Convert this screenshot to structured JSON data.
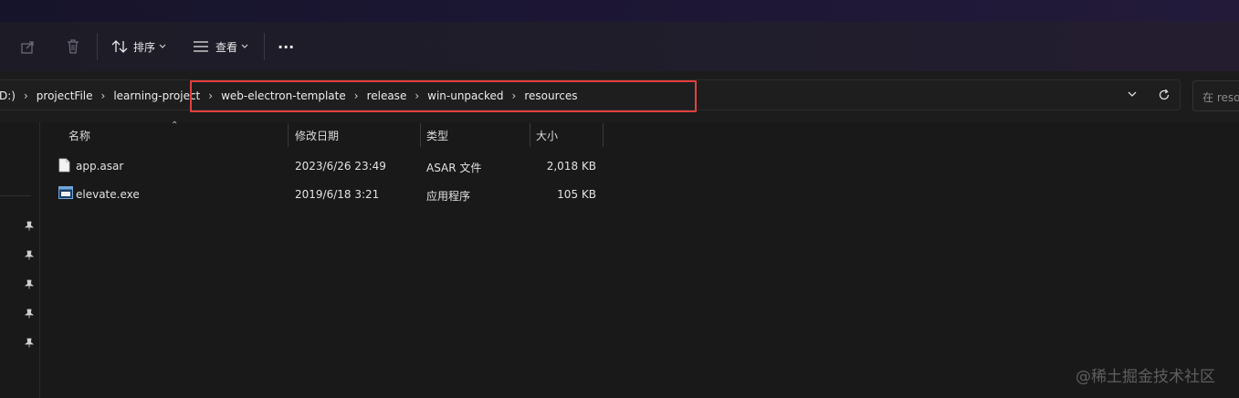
{
  "toolbar": {
    "sort_label": "排序",
    "view_label": "查看",
    "more_label": "···"
  },
  "address": {
    "crumbs": [
      "D:)",
      "projectFile",
      "learning-project",
      "web-electron-template",
      "release",
      "win-unpacked",
      "resources"
    ],
    "search_placeholder": "在 resources"
  },
  "columns": {
    "name": "名称",
    "modified": "修改日期",
    "type": "类型",
    "size": "大小"
  },
  "files": [
    {
      "name": "app.asar",
      "modified": "2023/6/26 23:49",
      "type": "ASAR 文件",
      "size": "2,018 KB",
      "icon": "file-icon"
    },
    {
      "name": "elevate.exe",
      "modified": "2019/6/18 3:21",
      "type": "应用程序",
      "size": "105 KB",
      "icon": "exe-icon"
    }
  ],
  "watermark": "@稀土掘金技术社区",
  "colors": {
    "highlight": "#e2403f",
    "background": "#191919"
  }
}
